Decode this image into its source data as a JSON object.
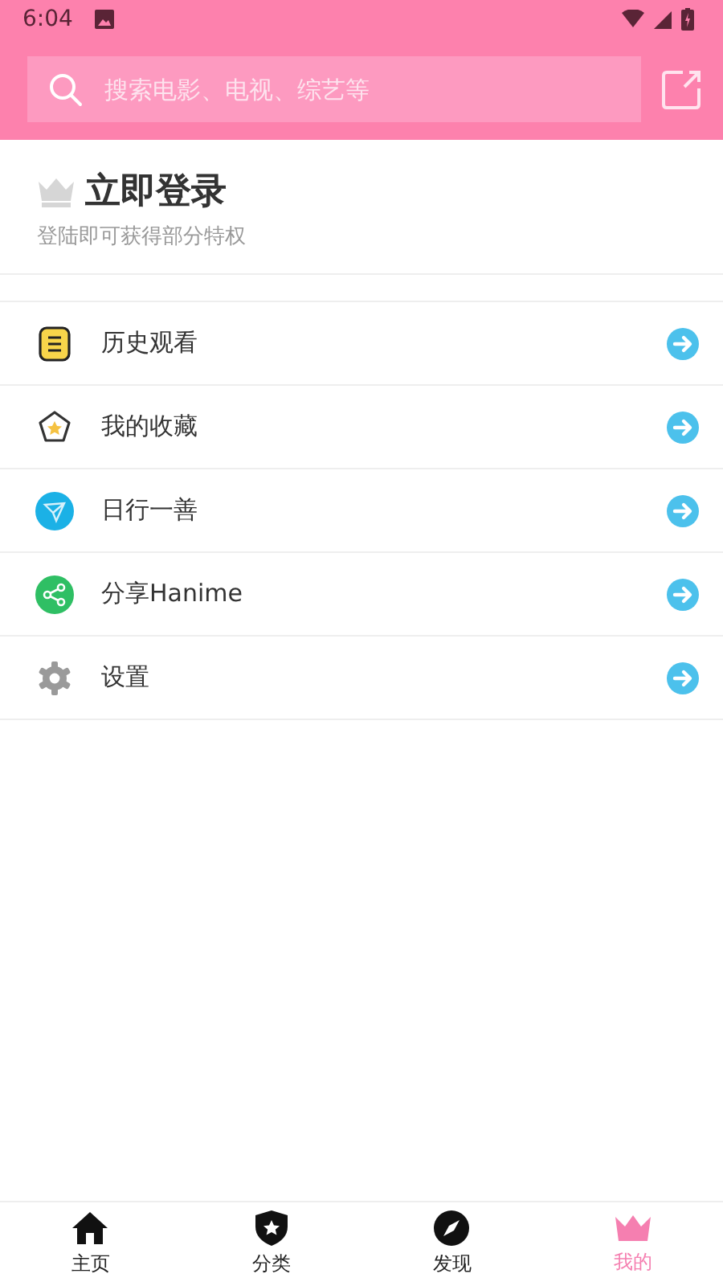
{
  "status_bar": {
    "time": "6:04"
  },
  "search": {
    "placeholder": "搜索电影、电视、综艺等"
  },
  "login": {
    "title": "立即登录",
    "subtitle": "登陆即可获得部分特权"
  },
  "menu": [
    {
      "kind": "history",
      "label": "历史观看"
    },
    {
      "kind": "favorite",
      "label": "我的收藏"
    },
    {
      "kind": "good-deed",
      "label": "日行一善"
    },
    {
      "kind": "share",
      "label": "分享Hanime"
    },
    {
      "kind": "settings",
      "label": "设置"
    }
  ],
  "tabs": [
    {
      "kind": "home",
      "label": "主页",
      "selected": false
    },
    {
      "kind": "category",
      "label": "分类",
      "selected": false
    },
    {
      "kind": "discover",
      "label": "发现",
      "selected": false
    },
    {
      "kind": "mine",
      "label": "我的",
      "selected": true
    }
  ]
}
